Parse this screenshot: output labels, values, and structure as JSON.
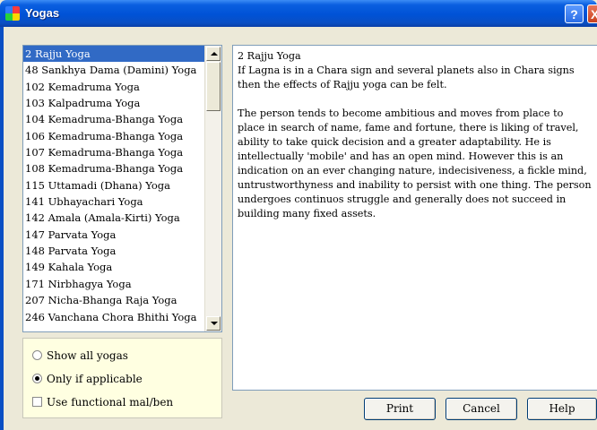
{
  "window": {
    "title": "Yogas",
    "help_glyph": "?",
    "close_glyph": "X"
  },
  "yoga_list": [
    "2 Rajju Yoga",
    "48 Sankhya Dama (Damini) Yoga",
    "102 Kemadruma Yoga",
    "103 Kalpadruma Yoga",
    "104 Kemadruma-Bhanga Yoga",
    "106 Kemadruma-Bhanga Yoga",
    "107 Kemadruma-Bhanga Yoga",
    "108 Kemadruma-Bhanga Yoga",
    "115 Uttamadi (Dhana) Yoga",
    "141 Ubhayachari Yoga",
    "142 Amala (Amala-Kirti) Yoga",
    "147 Parvata Yoga",
    "148 Parvata Yoga",
    "149 Kahala Yoga",
    "171 Nirbhagya Yoga",
    "207 Nicha-Bhanga Raja Yoga",
    "246 Vanchana Chora Bhithi Yoga"
  ],
  "selected_index": 0,
  "options": {
    "show_all": "Show all yogas",
    "only_applicable": "Only if applicable",
    "functional": "Use functional mal/ben",
    "selected": "only_applicable",
    "functional_checked": false
  },
  "detail": {
    "name": "2 Rajju Yoga",
    "condition": "If Lagna is in a Chara sign and several planets also in Chara signs then the effects of Rajju yoga can be felt.",
    "effect": "The person tends to become ambitious and moves from place to place in search of name, fame and fortune, there is liking of travel, ability to take quick decision and a greater adaptability. He is intellectually 'mobile' and has an open mind.  However this is an indication on an ever changing nature, indecisiveness, a fickle mind, untrustworthyness and inability to persist with one thing. The person undergoes continuos struggle and generally does not succeed in building many fixed assets."
  },
  "buttons": {
    "print": "Print",
    "cancel": "Cancel",
    "help": "Help"
  }
}
